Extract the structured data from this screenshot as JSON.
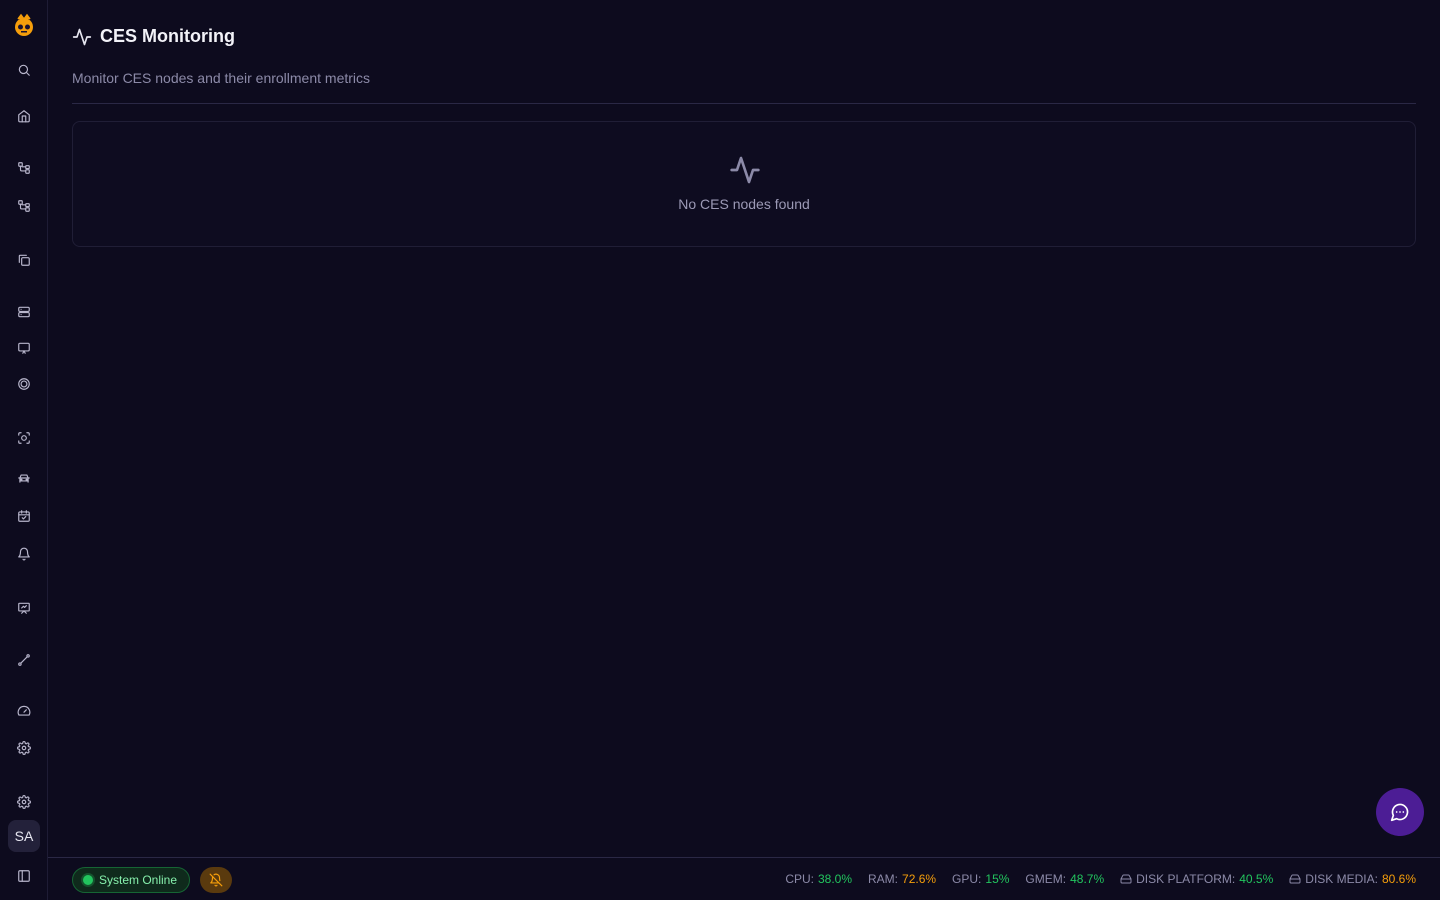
{
  "header": {
    "title": "CES Monitoring",
    "subtitle": "Monitor CES nodes and their enrollment metrics"
  },
  "empty_state": {
    "message": "No CES nodes found",
    "icon": "activity-icon"
  },
  "user": {
    "initials": "SA"
  },
  "sidebar": {
    "items": [
      {
        "icon": "search-icon"
      },
      {
        "icon": "home-icon"
      },
      {
        "icon": "workflow-icon"
      },
      {
        "icon": "workflow-icon"
      },
      {
        "icon": "copy-icon"
      },
      {
        "icon": "server-icon"
      },
      {
        "icon": "monitor-icon"
      },
      {
        "icon": "circle-icon"
      },
      {
        "icon": "scan-face-icon"
      },
      {
        "icon": "car-icon"
      },
      {
        "icon": "calendar-check-icon"
      },
      {
        "icon": "bell-icon"
      },
      {
        "icon": "presentation-icon"
      },
      {
        "icon": "route-icon"
      },
      {
        "icon": "gauge-icon"
      },
      {
        "icon": "gear-icon"
      },
      {
        "icon": "gear-icon"
      },
      {
        "icon": "sidebar-toggle-icon"
      }
    ]
  },
  "footer": {
    "status": "System Online",
    "metrics": [
      {
        "label": "CPU:",
        "value": "38.0%",
        "level": "green"
      },
      {
        "label": "RAM:",
        "value": "72.6%",
        "level": "amber"
      },
      {
        "label": "GPU:",
        "value": "15%",
        "level": "green"
      },
      {
        "label": "GMEM:",
        "value": "48.7%",
        "level": "green"
      },
      {
        "label": "DISK PLATFORM:",
        "value": "40.5%",
        "level": "green",
        "icon": "hard-drive-icon"
      },
      {
        "label": "DISK MEDIA:",
        "value": "80.6%",
        "level": "amber",
        "icon": "hard-drive-icon"
      }
    ]
  },
  "colors": {
    "background": "#0d0b1e",
    "accent": "#4c1d95",
    "ok": "#22c55e",
    "warn": "#f59e0b"
  }
}
